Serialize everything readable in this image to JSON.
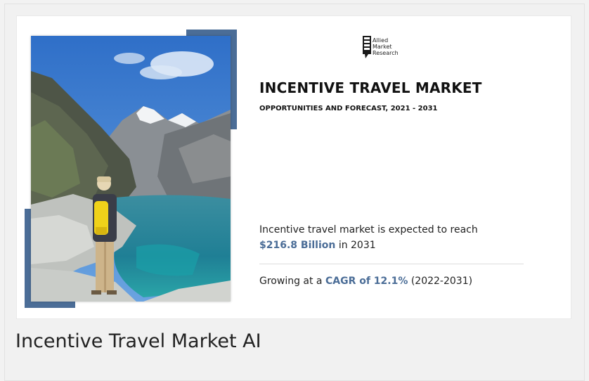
{
  "logo": {
    "line1": "Allied",
    "line2": "Market",
    "line3": "Research"
  },
  "report": {
    "title": "INCENTIVE TRAVEL MARKET",
    "subtitle": "OPPORTUNITIES AND FORECAST, 2021 - 2031"
  },
  "stat_market": {
    "prefix": "Incentive travel market is expected to reach",
    "value": "$216.8 Billion",
    "suffix": "in 2031"
  },
  "stat_cagr": {
    "prefix": "Growing at a",
    "value": "CAGR of 12.1%",
    "suffix": "(2022-2031)"
  },
  "caption": "Incentive Travel Market AI",
  "colors": {
    "accent": "#4b6d97",
    "sky": "#3f7fcf",
    "lake": "#2f8f9a"
  },
  "icons": {
    "photo": "mountain-lake-hiker-photo",
    "logo": "allied-market-research-logo"
  }
}
